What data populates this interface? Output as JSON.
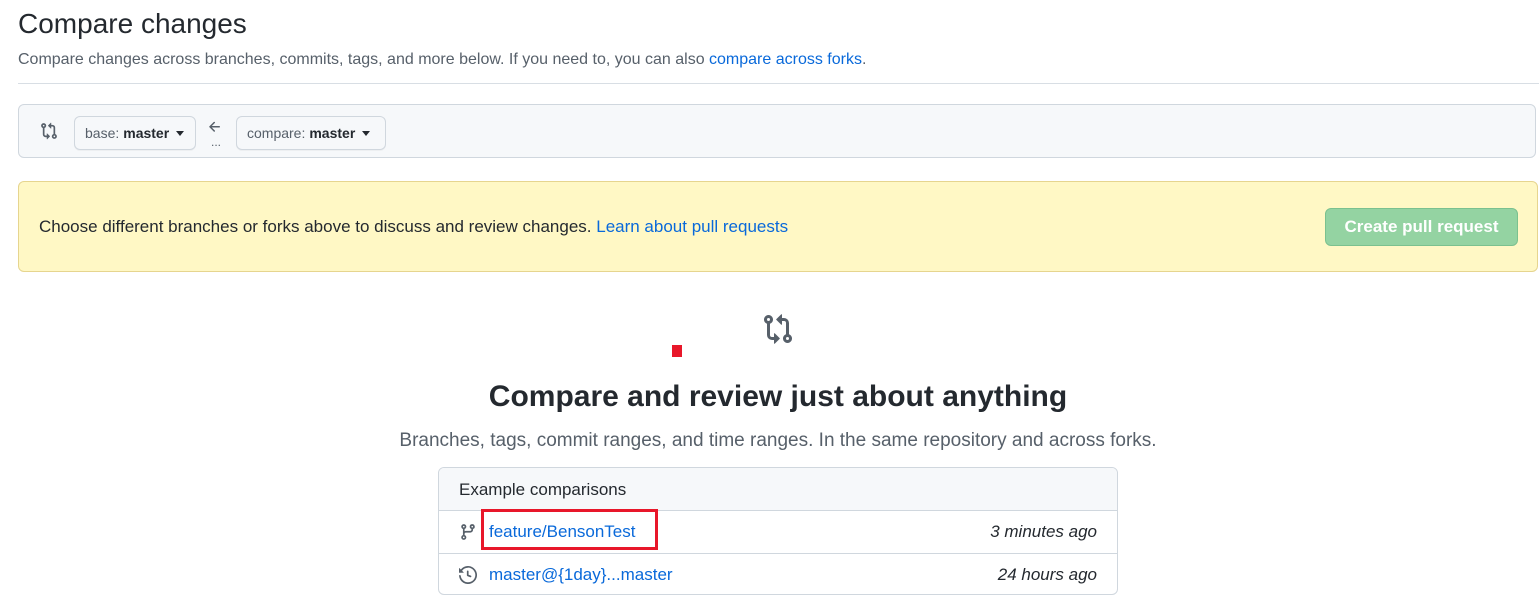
{
  "header": {
    "title": "Compare changes",
    "subtitle_text": "Compare changes across branches, commits, tags, and more below. If you need to, you can also ",
    "subtitle_link": "compare across forks",
    "subtitle_end": "."
  },
  "range": {
    "base_prefix": "base:",
    "base_value": "master",
    "compare_prefix": "compare:",
    "compare_value": "master",
    "dots": "..."
  },
  "flash": {
    "text": "Choose different branches or forks above to discuss and review changes. ",
    "link": "Learn about pull requests",
    "button": "Create pull request"
  },
  "hero": {
    "title": "Compare and review just about anything",
    "subtitle": "Branches, tags, commit ranges, and time ranges. In the same repository and across forks."
  },
  "examples": {
    "header": "Example comparisons",
    "rows": [
      {
        "icon": "branch-icon",
        "label": "feature/BensonTest",
        "time": "3 minutes ago"
      },
      {
        "icon": "history-icon",
        "label": "master@{1day}...master",
        "time": "24 hours ago"
      }
    ]
  },
  "colors": {
    "link": "#0969da",
    "flash_bg": "#fff8c5",
    "button_disabled": "#94d3a2",
    "annotation_red": "#e8172a"
  }
}
